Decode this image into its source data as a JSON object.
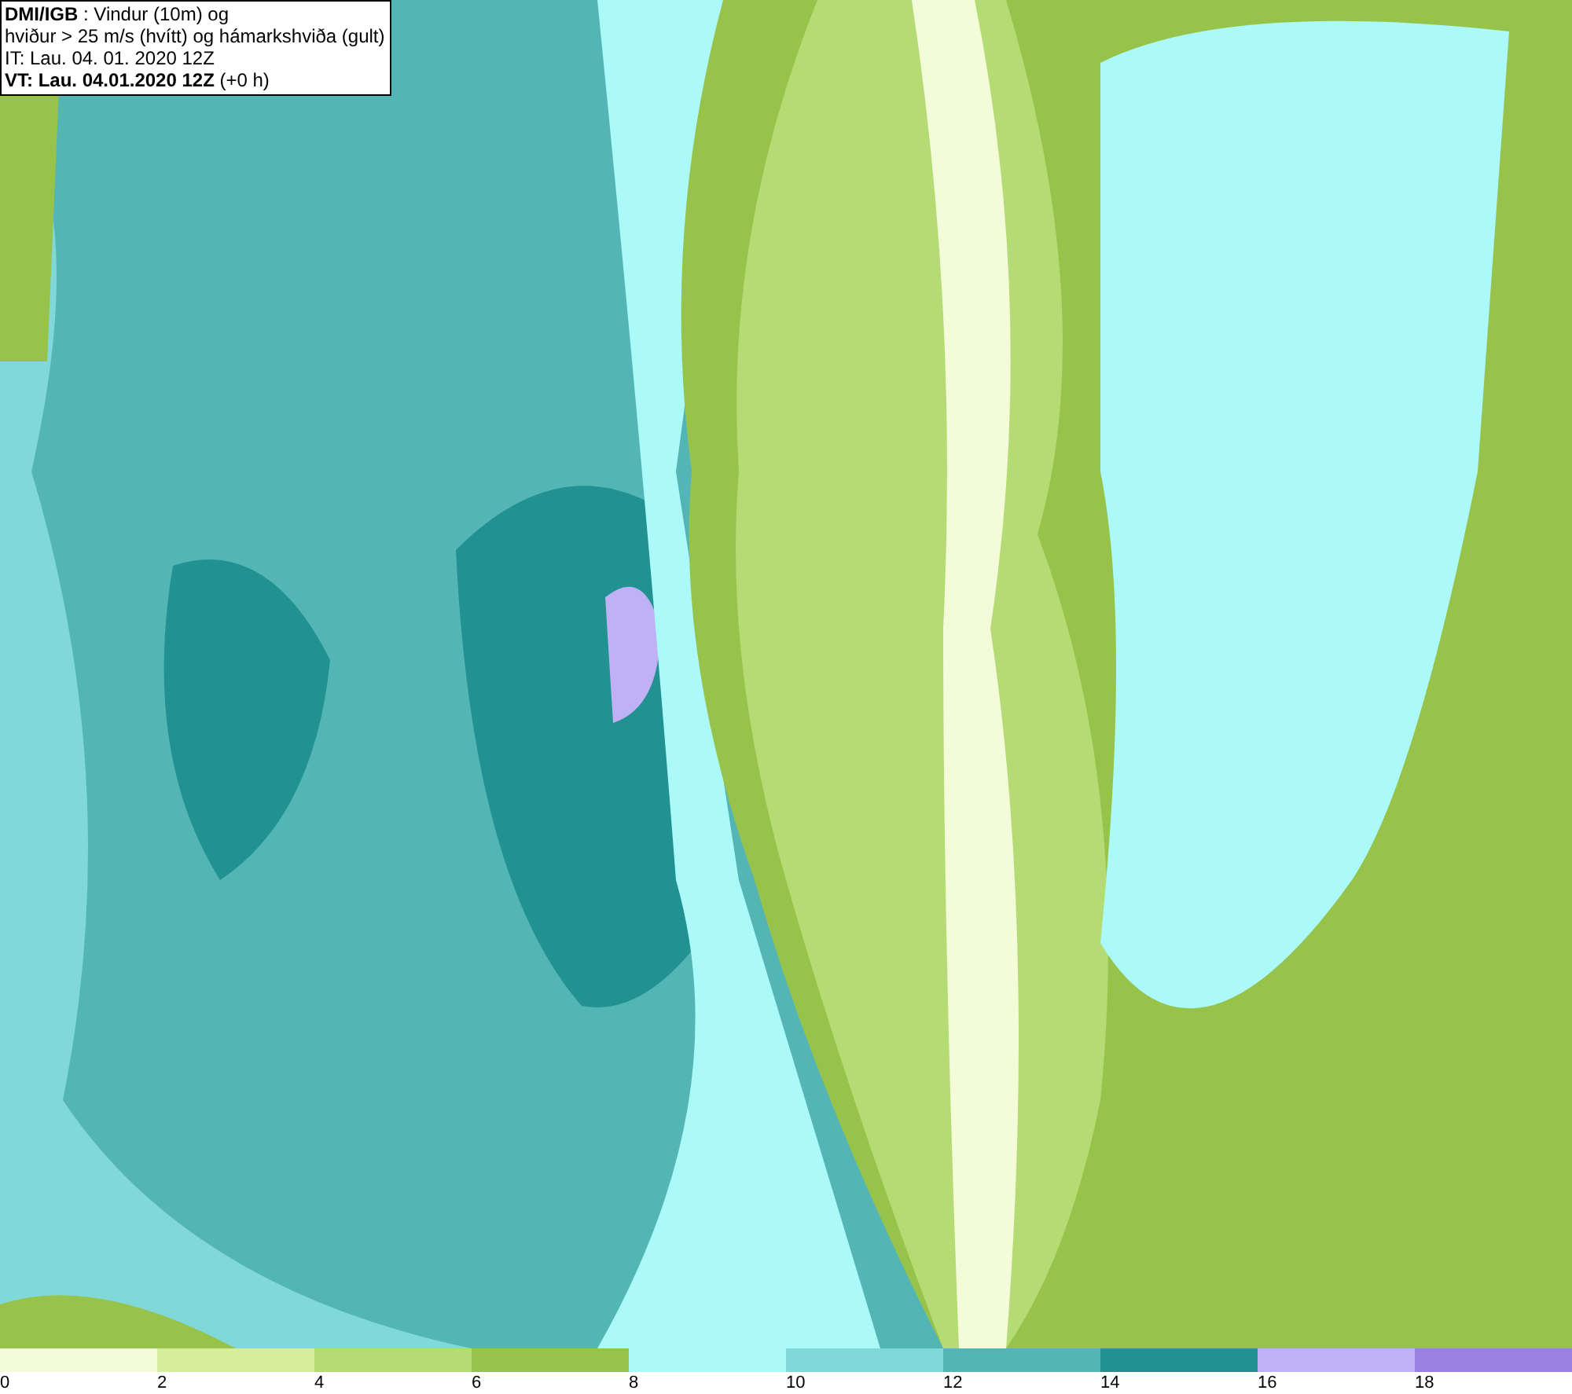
{
  "header": {
    "lines": [
      "**DMI/IGB** : Vindur (10m) og",
      "hviður > 25 m/s (hvítt) og hámarkshviða (gult)",
      "IT: Lau. 04. 01. 2020 12Z",
      "**VT: Lau. 04.01.2020 12Z** (+0 h)"
    ]
  },
  "legend": [
    {
      "label": "0",
      "color": "#f4fbd9"
    },
    {
      "label": "2",
      "color": "#d4ee9c"
    },
    {
      "label": "4",
      "color": "#b5db74"
    },
    {
      "label": "6",
      "color": "#98c34a"
    },
    {
      "label": "8",
      "color": "#acf9f9"
    },
    {
      "label": "10",
      "color": "#80d8d8"
    },
    {
      "label": "12",
      "color": "#54b5b5"
    },
    {
      "label": "14",
      "color": "#229191"
    },
    {
      "label": "16",
      "color": "#c0b1f5"
    },
    {
      "label": "18",
      "color": "#9a80e0"
    }
  ]
}
